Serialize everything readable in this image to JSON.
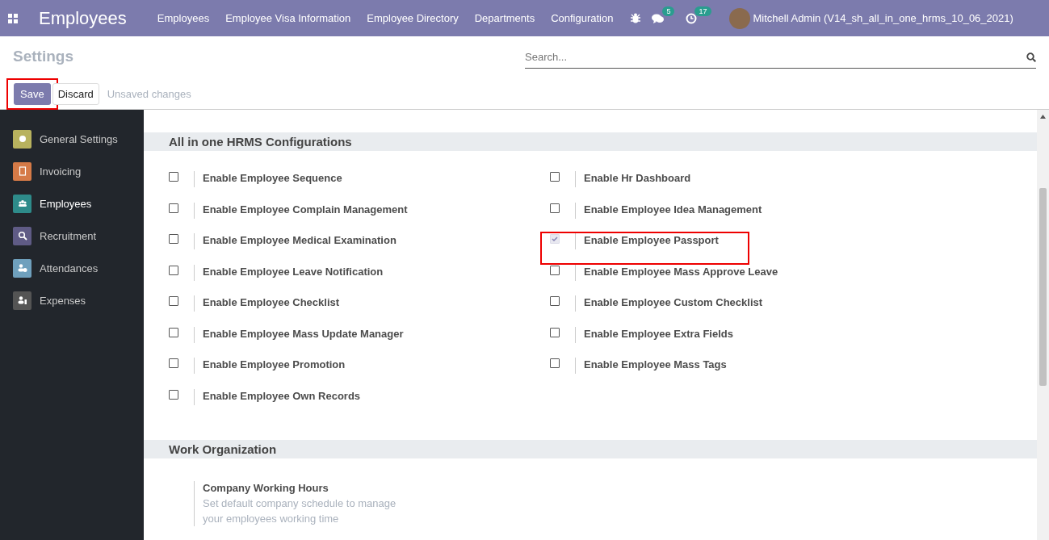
{
  "navbar": {
    "app_title": "Employees",
    "menu": [
      "Employees",
      "Employee Visa Information",
      "Employee Directory",
      "Departments",
      "Configuration"
    ],
    "messages_count": "5",
    "activities_count": "17",
    "user": "Mitchell Admin (V14_sh_all_in_one_hrms_10_06_2021)"
  },
  "control_panel": {
    "title": "Settings",
    "search": {
      "placeholder": "Search..."
    },
    "save": {
      "label": "Save",
      "highlighted": true
    },
    "discard": "Discard",
    "status": "Unsaved changes"
  },
  "sidebar": {
    "items": [
      {
        "label": "General Settings",
        "color": "#b8b25e",
        "selected": false
      },
      {
        "label": "Invoicing",
        "color": "#d57a47",
        "selected": false
      },
      {
        "label": "Employees",
        "color": "#2e8b8a",
        "selected": true
      },
      {
        "label": "Recruitment",
        "color": "#5f5b85",
        "selected": false
      },
      {
        "label": "Attendances",
        "color": "#6fa0bd",
        "selected": false
      },
      {
        "label": "Expenses",
        "color": "#545454",
        "selected": false
      }
    ]
  },
  "sections": [
    {
      "title": "All in one HRMS Configurations",
      "left_column": [
        {
          "label": "Enable Employee Sequence",
          "checked": false,
          "highlighted": false
        },
        {
          "label": "Enable Employee Complain Management",
          "checked": false,
          "highlighted": false
        },
        {
          "label": "Enable Employee Medical Examination",
          "checked": false,
          "highlighted": false
        },
        {
          "label": "Enable Employee Leave Notification",
          "checked": false,
          "highlighted": false
        },
        {
          "label": "Enable Employee Checklist",
          "checked": false,
          "highlighted": false
        },
        {
          "label": "Enable Employee Mass Update Manager",
          "checked": false,
          "highlighted": false
        },
        {
          "label": "Enable Employee Promotion",
          "checked": false,
          "highlighted": false
        },
        {
          "label": "Enable Employee Own Records",
          "checked": false,
          "highlighted": false
        }
      ],
      "right_column": [
        {
          "label": "Enable Hr Dashboard",
          "checked": false,
          "highlighted": false
        },
        {
          "label": "Enable Employee Idea Management",
          "checked": false,
          "highlighted": false
        },
        {
          "label": "Enable Employee Passport",
          "checked": true,
          "highlighted": true
        },
        {
          "label": "Enable Employee Mass Approve Leave",
          "checked": false,
          "highlighted": false
        },
        {
          "label": "Enable Employee Custom Checklist",
          "checked": false,
          "highlighted": false
        },
        {
          "label": "Enable Employee Extra Fields",
          "checked": false,
          "highlighted": false
        },
        {
          "label": "Enable Employee Mass Tags",
          "checked": false,
          "highlighted": false
        }
      ]
    },
    {
      "title": "Work Organization",
      "left_column": [
        {
          "label": "Company Working Hours",
          "description": "Set default company schedule to manage your employees working time"
        }
      ]
    }
  ]
}
